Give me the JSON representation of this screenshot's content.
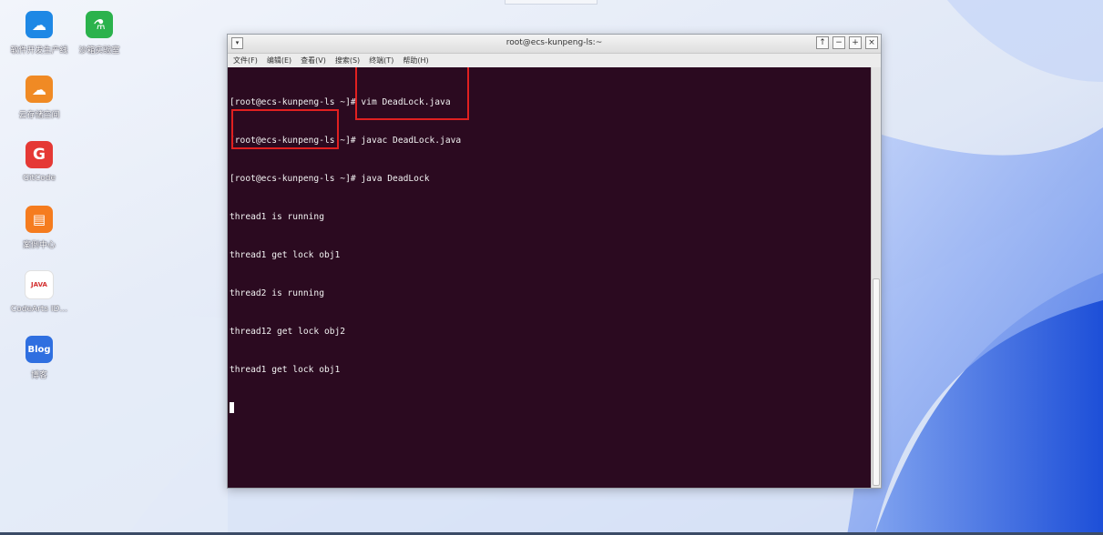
{
  "desktop": {
    "icons": [
      {
        "label": "软件开发生产线",
        "icon": "cloud-devops-icon",
        "color": "#1e88e5",
        "glyph": "☁"
      },
      {
        "label": "沙箱实验室",
        "icon": "lab-flask-icon",
        "color": "#2bb24c",
        "glyph": "⚗"
      },
      {
        "label": "云存储空间",
        "icon": "cloud-storage-icon",
        "color": "#f08a24",
        "glyph": "☁"
      },
      {
        "label": "GitCode",
        "icon": "gitcode-icon",
        "color": "#e53935",
        "glyph": "G"
      },
      {
        "label": "案例中心",
        "icon": "case-center-icon",
        "color": "#f57c1f",
        "glyph": "▤"
      },
      {
        "label": "CodeArts ID...",
        "icon": "java-icon",
        "color": "#ffffff",
        "glyph": "JAVA"
      },
      {
        "label": "博客",
        "icon": "blog-icon",
        "color": "#2f6fe0",
        "glyph": "Blog"
      }
    ]
  },
  "window": {
    "title": "root@ecs-kunpeng-ls:~",
    "menu_button_glyph": "▾",
    "controls": {
      "up": "↑",
      "minimize": "−",
      "maximize": "+",
      "close": "×"
    },
    "menu": [
      "文件(F)",
      "编辑(E)",
      "查看(V)",
      "搜索(S)",
      "终端(T)",
      "帮助(H)"
    ]
  },
  "terminal": {
    "background": "#2b0a20",
    "lines": [
      "[root@ecs-kunpeng-ls ~]# vim DeadLock.java",
      "[root@ecs-kunpeng-ls ~]# javac DeadLock.java",
      "[root@ecs-kunpeng-ls ~]# java DeadLock",
      "thread1 is running",
      "thread1 get lock obj1",
      "thread2 is running",
      "thread12 get lock obj2",
      "thread1 get lock obj1"
    ]
  },
  "annotation_color": "#e02020"
}
